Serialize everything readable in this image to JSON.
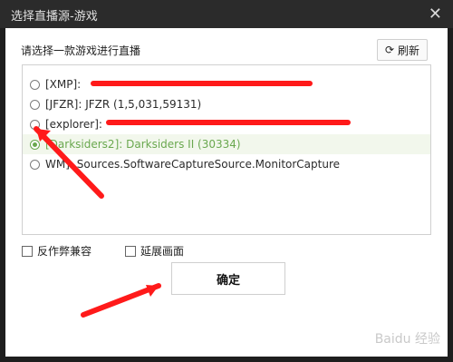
{
  "window": {
    "title": "选择直播源-游戏",
    "close_icon": "close-icon"
  },
  "main": {
    "prompt": "请选择一款游戏进行直播",
    "refresh_label": "刷新",
    "list": [
      {
        "label": "[XMP]:",
        "selected": false
      },
      {
        "label": "[JFZR]: JFZR (1,5,031,59131)",
        "selected": false
      },
      {
        "label": "[explorer]:",
        "selected": false
      },
      {
        "label": "[Darksiders2]: Darksiders II (30334)",
        "selected": true
      },
      {
        "label": "WM]: Sources.SoftwareCaptureSource.MonitorCapture",
        "selected": false
      }
    ],
    "options": {
      "anti_cheat": "反作弊兼容",
      "extend_screen": "延展画面"
    },
    "ok_label": "确定"
  },
  "watermark": "Baidu 经验"
}
